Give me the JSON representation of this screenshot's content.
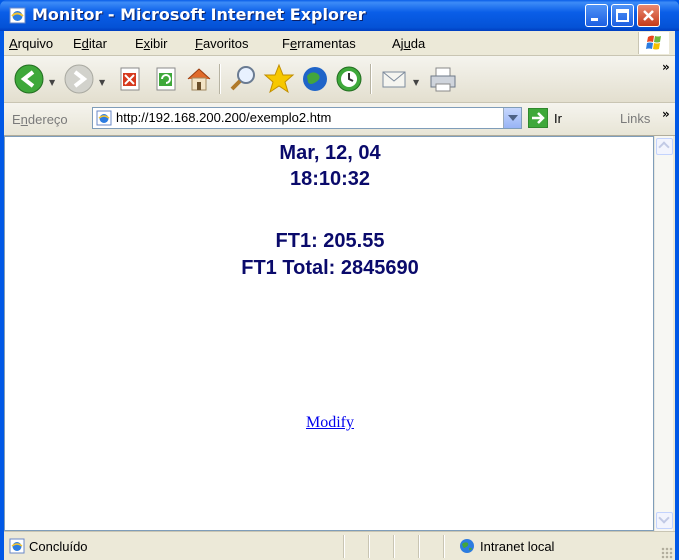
{
  "window": {
    "title": "Monitor - Microsoft Internet Explorer"
  },
  "menu": {
    "items": [
      "Arquivo",
      "Editar",
      "Exibir",
      "Favoritos",
      "Ferramentas",
      "Ajuda"
    ]
  },
  "toolbar": {
    "buttons": [
      "back-icon",
      "forward-icon",
      "stop-icon",
      "refresh-icon",
      "home-icon",
      "search-icon",
      "favorites-icon",
      "media-icon",
      "history-icon",
      "mail-icon",
      "print-icon"
    ],
    "overflow": "»"
  },
  "address": {
    "label": "Endereço",
    "url": "http://192.168.200.200/exemplo2.htm",
    "go_label": "Ir",
    "links_label": "Links",
    "links_overflow": "»"
  },
  "page": {
    "date": "Mar, 12, 04",
    "time": "18:10:32",
    "ft1": "FT1: 205.55",
    "ft1_total": "FT1 Total: 2845690",
    "modify_link": "Modify",
    "text_color": "#0a0a6b",
    "link_color": "#0000ee"
  },
  "status": {
    "text": "Concluído",
    "zone": "Intranet local"
  }
}
